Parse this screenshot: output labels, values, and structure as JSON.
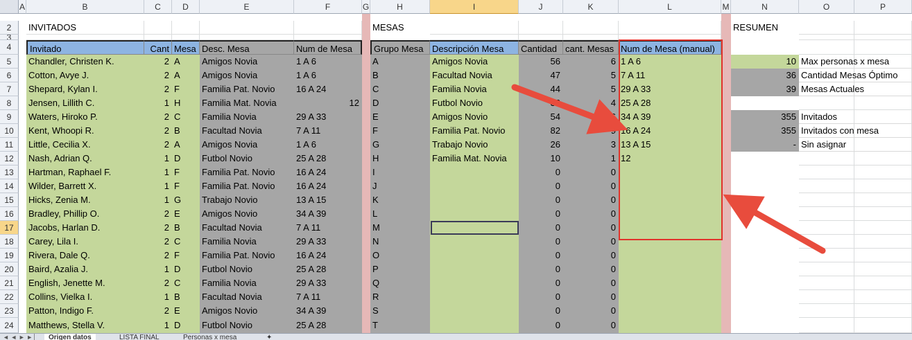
{
  "columns": [
    "A",
    "B",
    "C",
    "D",
    "E",
    "F",
    "G",
    "H",
    "I",
    "J",
    "K",
    "L",
    "M",
    "N",
    "O",
    "P"
  ],
  "selected_column": "I",
  "rows": [
    "2",
    "3",
    "4",
    "5",
    "6",
    "7",
    "8",
    "9",
    "10",
    "11",
    "12",
    "13",
    "14",
    "15",
    "16",
    "17",
    "18",
    "19",
    "20",
    "21",
    "22",
    "23",
    "24"
  ],
  "selected_row": "17",
  "titles": {
    "invitados": "INVITADOS",
    "mesas": "MESAS",
    "resumen": "RESUMEN"
  },
  "headers": {
    "invitado": "Invitado",
    "cant": "Cant",
    "mesa": "Mesa",
    "desc_mesa": "Desc. Mesa",
    "num_de_mesa": "Num de Mesa",
    "grupo_mesa": "Grupo Mesa",
    "descripcion_mesa": "Descripción Mesa",
    "cantidad": "Cantidad",
    "cant_mesas": "cant. Mesas",
    "num_mesa_manual": "Num de Mesa (manual)"
  },
  "guests": [
    [
      "Chandler, Christen K.",
      "2",
      "A",
      "Amigos Novia",
      "1 A 6"
    ],
    [
      "Cotton, Avye J.",
      "2",
      "A",
      "Amigos Novia",
      "1 A 6"
    ],
    [
      "Shepard, Kylan I.",
      "2",
      "F",
      "Familia Pat. Novio",
      "16 A 24"
    ],
    [
      "Jensen, Lillith C.",
      "1",
      "H",
      "Familia Mat. Novia",
      "12"
    ],
    [
      "Waters, Hiroko P.",
      "2",
      "C",
      "Familia Novia",
      "29 A 33"
    ],
    [
      "Kent, Whoopi R.",
      "2",
      "B",
      "Facultad  Novia",
      "7 A 11"
    ],
    [
      "Little, Cecilia X.",
      "2",
      "A",
      "Amigos Novia",
      "1 A 6"
    ],
    [
      "Nash, Adrian Q.",
      "1",
      "D",
      "Futbol Novio",
      "25 A 28"
    ],
    [
      "Hartman, Raphael F.",
      "1",
      "F",
      "Familia Pat. Novio",
      "16 A 24"
    ],
    [
      "Wilder, Barrett X.",
      "1",
      "F",
      "Familia Pat. Novio",
      "16 A 24"
    ],
    [
      "Hicks, Zenia M.",
      "1",
      "G",
      "Trabajo Novio",
      "13 A 15"
    ],
    [
      "Bradley, Phillip O.",
      "2",
      "E",
      "Amigos Novio",
      "34 A 39"
    ],
    [
      "Jacobs, Harlan D.",
      "2",
      "B",
      "Facultad  Novia",
      "7 A 11"
    ],
    [
      "Carey, Lila I.",
      "2",
      "C",
      "Familia Novia",
      "29 A 33"
    ],
    [
      "Rivera, Dale Q.",
      "2",
      "F",
      "Familia Pat. Novio",
      "16 A 24"
    ],
    [
      "Baird, Azalia J.",
      "1",
      "D",
      "Futbol Novio",
      "25 A 28"
    ],
    [
      "English, Jenette M.",
      "2",
      "C",
      "Familia Novia",
      "29 A 33"
    ],
    [
      "Collins, Vielka I.",
      "1",
      "B",
      "Facultad  Novia",
      "7 A 11"
    ],
    [
      "Patton, Indigo F.",
      "2",
      "E",
      "Amigos Novio",
      "34 A 39"
    ],
    [
      "Matthews, Stella V.",
      "1",
      "D",
      "Futbol Novio",
      "25 A 28"
    ]
  ],
  "mesas": [
    [
      "A",
      "Amigos Novia",
      "56",
      "6",
      "1 A 6"
    ],
    [
      "B",
      "Facultad  Novia",
      "47",
      "5",
      "7 A 11"
    ],
    [
      "C",
      "Familia Novia",
      "44",
      "5",
      "29 A 33"
    ],
    [
      "D",
      "Futbol Novio",
      "36",
      "4",
      "25 A 28"
    ],
    [
      "E",
      "Amigos Novio",
      "54",
      "6",
      "34 A 39"
    ],
    [
      "F",
      "Familia Pat. Novio",
      "82",
      "9",
      "16 A 24"
    ],
    [
      "G",
      "Trabajo Novio",
      "26",
      "3",
      "13 A 15"
    ],
    [
      "H",
      "Familia Mat. Novia",
      "10",
      "1",
      "12"
    ],
    [
      "I",
      "",
      "0",
      "0",
      ""
    ],
    [
      "J",
      "",
      "0",
      "0",
      ""
    ],
    [
      "K",
      "",
      "0",
      "0",
      ""
    ],
    [
      "L",
      "",
      "0",
      "0",
      ""
    ],
    [
      "M",
      "",
      "0",
      "0",
      ""
    ],
    [
      "N",
      "",
      "0",
      "0",
      ""
    ],
    [
      "O",
      "",
      "0",
      "0",
      ""
    ],
    [
      "P",
      "",
      "0",
      "0",
      ""
    ],
    [
      "Q",
      "",
      "0",
      "0",
      ""
    ],
    [
      "R",
      "",
      "0",
      "0",
      ""
    ],
    [
      "S",
      "",
      "0",
      "0",
      ""
    ],
    [
      "T",
      "",
      "0",
      "0",
      ""
    ]
  ],
  "resumen": [
    {
      "value": "10",
      "label": "Max personas x mesa"
    },
    {
      "value": "36",
      "label": "Cantidad Mesas Óptimo"
    },
    {
      "value": "39",
      "label": "Mesas Actuales"
    },
    {
      "value": "",
      "label": ""
    },
    {
      "value": "355",
      "label": "Invitados"
    },
    {
      "value": "355",
      "label": "Invitados con mesa"
    },
    {
      "value": "-",
      "label": "Sin asignar"
    }
  ],
  "sheet_tabs": [
    "Origen datos",
    "LISTA FINAL",
    "Personas x mesa"
  ],
  "active_tab": "Origen datos",
  "colors": {
    "green": "#c4d79b",
    "gray": "#a6a6a6",
    "blue_header": "#8db4e2",
    "pink_divider": "#e6b8b7",
    "highlight_box": "#e0332b",
    "arrow": "#e84c3d"
  }
}
